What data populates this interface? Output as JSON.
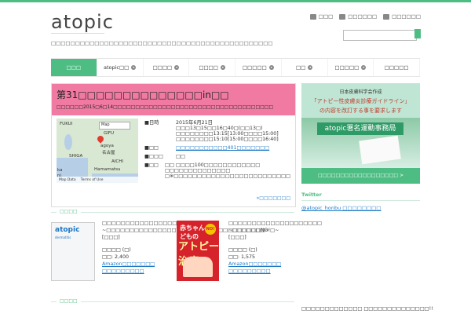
{
  "header": {
    "logo": "atopic",
    "tagline": "□□□□□□□□□□□□□□□□□□□□□□□□□□□□□□□□□□□□□□□□□□□□□□",
    "links": [
      {
        "icon": "sitemap-icon",
        "label": "□□□"
      },
      {
        "icon": "mail-icon",
        "label": "□□□□□□"
      },
      {
        "icon": "home-icon",
        "label": "□□□□□□"
      }
    ],
    "search_placeholder": ""
  },
  "nav": {
    "tabs": [
      {
        "label": "□□□",
        "active": true,
        "chevron": false
      },
      {
        "label": "atopic□□",
        "active": false,
        "chevron": true
      },
      {
        "label": "□□□□",
        "active": false,
        "chevron": true
      },
      {
        "label": "□□□□",
        "active": false,
        "chevron": true
      },
      {
        "label": "□□□□□",
        "active": false,
        "chevron": true
      },
      {
        "label": "□□",
        "active": false,
        "chevron": true
      },
      {
        "label": "□□□□□",
        "active": false,
        "chevron": true
      },
      {
        "label": "□□□□□",
        "active": false,
        "chevron": false
      }
    ]
  },
  "event": {
    "title": "第31□□□□□□□□□□□□□□in□□",
    "subtitle": "□□□□□□2015□6□14□□□□□□□□□□□□□□□□□□□□□□□□□□□□□□□□□□□□",
    "map_labels": {
      "mapbtn": "Map",
      "fukui": "FUKUI",
      "gifu": "GIFU",
      "nagoya": "agoya",
      "nagoya2": "名古屋",
      "shiga": "SHIGA",
      "aichi": "AICHI",
      "hamamatsu": "Hamamatsu",
      "ka": "ka",
      "ni": "ni",
      "footer1": "Map Data",
      "footer2": "Terms of Use"
    },
    "rows": [
      {
        "key": "■日時",
        "values": [
          "2015年6月21日□□□13□15□□16□40□(□□13□)",
          "□□□□□□□□13:15[13:00□□□□15:00]",
          "□□□□□□□□15:10[15:00□□□□16:40]"
        ],
        "link": false
      },
      {
        "key": "■□□",
        "values": [
          "□□□□□□□□□□□401□□□□□□□"
        ],
        "link": true
      },
      {
        "key": "■□□□",
        "values": [
          "□□"
        ],
        "link": false
      },
      {
        "key": "■□□",
        "values": [
          "□□ □□□□100□□□□□□□□□□□□ □□□□□□□□□□□□□□",
          "□※□□□□□□□□□□□□□□□□□□□□□□□□□"
        ],
        "link": false
      }
    ],
    "more_link": "»□□□□□□□"
  },
  "ad": {
    "line1": "日本皮膚科学会作成",
    "line2": "「アトピー性皮膚炎診療ガイドライン」",
    "line3": "の内容を改訂する事を要求します",
    "badge": "atopic署名運動事務局",
    "cta": "□□□□□□□□□□□□□□□□□□ >"
  },
  "twitter": {
    "title": "Twitter",
    "link": "@atopic_honbu □□□□□□□□"
  },
  "sections": {
    "books": "□□□□",
    "next": "□□□□"
  },
  "books": [
    {
      "cover_title": "atopic",
      "cover_sub": "dermatitis",
      "title": "□□□□□□□□□□□□□□□□□□□□□□",
      "subtitle": "~□□□□□□□□□□□□□□□□□□□□□□□□□□□□□□□□□□~",
      "bracket": "[□□□]",
      "label": "□□□□ (□)",
      "price": "□□: 2,400",
      "amazon": "Amazon□□□□□□□",
      "detail": "□□□□□□□□□"
    },
    {
      "cover_title": "赤ちゃん 子どもの",
      "cover_badge": "NO!",
      "cover_big": "アトピー治療",
      "title": "□□□□□□□□□□□□□□□□□□□□",
      "subtitle": "~□□□□□□NO!□~",
      "bracket": "[□□□]",
      "label": "□□□□ (□)",
      "price": "□□: 1,575",
      "amazon": "Amazon□□□□□□□",
      "detail": "□□□□□□□□□"
    }
  ],
  "footer_right": "□□□□□□□□□□□□□ □□□□□□□□□□□□□□!!",
  "colors": {
    "accent": "#4ebd83",
    "pink": "#f07aa2",
    "link": "#1d7ac6"
  }
}
